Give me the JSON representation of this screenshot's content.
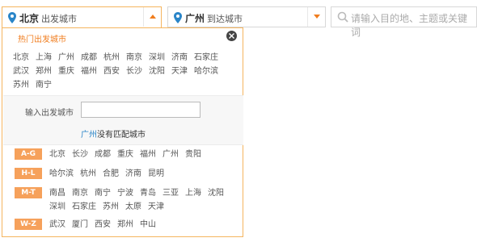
{
  "search": {
    "origin": {
      "city": "北京",
      "label": "出发城市"
    },
    "destination": {
      "city": "广州",
      "label": "到达城市"
    },
    "keyword_placeholder": "请输入目的地、主题或关键词"
  },
  "dropdown": {
    "hot_title": "热门出发城市",
    "hot_cities": [
      [
        "北京",
        "上海",
        "广州",
        "成都",
        "杭州",
        "南京",
        "深圳",
        "济南",
        "石家庄"
      ],
      [
        "武汉",
        "郑州",
        "重庆",
        "福州",
        "西安",
        "长沙",
        "沈阳",
        "天津",
        "哈尔滨"
      ],
      [
        "苏州",
        "南宁"
      ]
    ],
    "input_label": "输入出发城市",
    "input_value": "",
    "nomatch": {
      "city": "广州",
      "text": "没有匹配城市"
    },
    "groups": [
      {
        "tag": "A-G",
        "cities": [
          "北京",
          "长沙",
          "成都",
          "重庆",
          "福州",
          "广州",
          "贵阳"
        ]
      },
      {
        "tag": "H-L",
        "cities": [
          "哈尔滨",
          "杭州",
          "合肥",
          "济南",
          "昆明"
        ]
      },
      {
        "tag": "M-T",
        "cities": [
          "南昌",
          "南京",
          "南宁",
          "宁波",
          "青岛",
          "三亚",
          "上海",
          "沈阳",
          "深圳",
          "石家庄",
          "苏州",
          "太原",
          "天津"
        ]
      },
      {
        "tag": "W-Z",
        "cities": [
          "武汉",
          "厦门",
          "西安",
          "郑州",
          "中山"
        ]
      }
    ]
  },
  "colors": {
    "accent": "#f07d1e",
    "tag_bg": "#f6a15b",
    "pin": "#2a85c8",
    "link": "#2a85c8"
  }
}
